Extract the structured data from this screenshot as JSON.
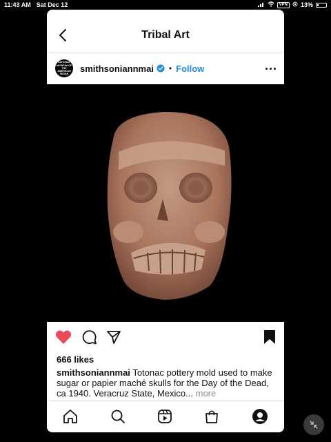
{
  "status": {
    "time": "11:43 AM",
    "date": "Sat Dec 12",
    "vpn": "VPN",
    "battery": "13%",
    "battery_level": 0.13
  },
  "header": {
    "title": "Tribal Art"
  },
  "post": {
    "avatar_text": "NATIONAL MUSEUM OF THE AMERICAN INDIAN",
    "username": "smithsoniannmai",
    "follow": "Follow",
    "likes": "666 likes",
    "caption_user": "smithsoniannmai",
    "caption_text": "Totonac pottery mold used to make sugar or papier maché skulls for the Day of the Dead, ca 1940. Veracruz State, Mexico...",
    "more": "more"
  },
  "colors": {
    "like": "#ed4956",
    "link": "#1d8cf0",
    "muted": "#8e8e8e"
  },
  "icons": {
    "back": "chevron-left-icon",
    "verified": "verified-badge-icon",
    "more": "more-dots-icon",
    "like": "heart-icon",
    "comment": "comment-icon",
    "share": "send-icon",
    "save": "bookmark-icon",
    "nav": [
      "home-icon",
      "search-icon",
      "reels-icon",
      "shop-icon",
      "profile-icon"
    ]
  }
}
